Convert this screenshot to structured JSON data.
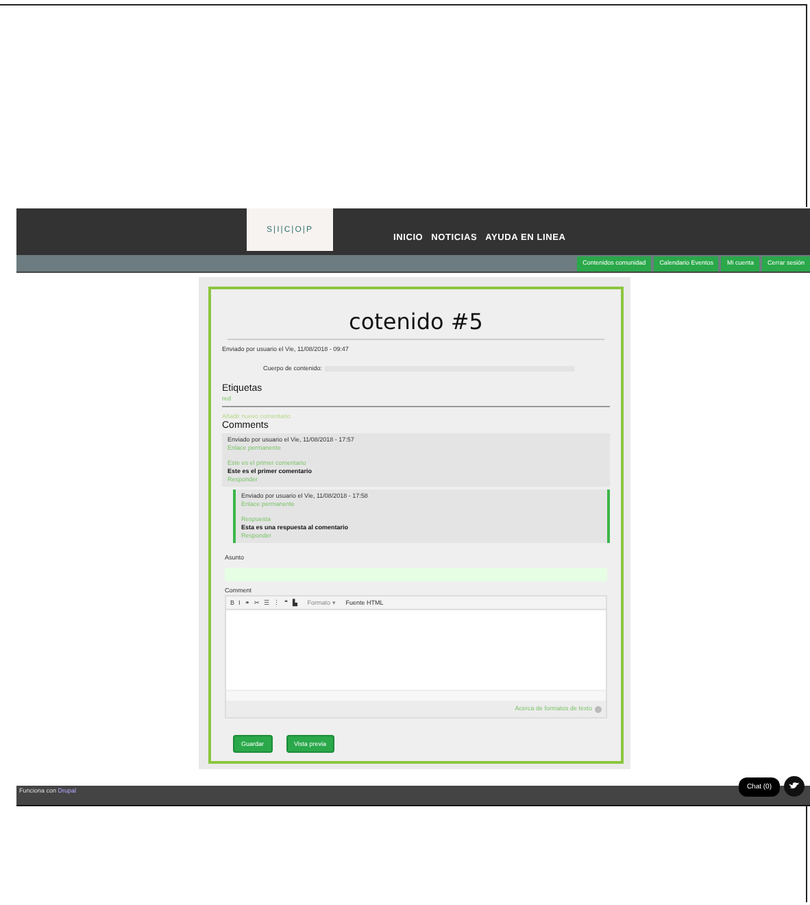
{
  "header": {
    "logo": "S|I|C|O|P",
    "nav": [
      "INICIO",
      "NOTICIAS",
      "AYUDA EN LINEA"
    ],
    "user_menu": [
      "Contenidos comunidad",
      "Calendario Eventos",
      "Mi cuenta",
      "Cerrar sesión"
    ]
  },
  "article": {
    "title": "cotenido #5",
    "meta": "Enviado por usuario el Vie, 11/08/2018 - 09:47",
    "body_label": "Cuerpo de contenido:",
    "tags_heading": "Etiquetas",
    "tags": [
      "red"
    ],
    "add_comment_link": "Añadir nuevo comentario"
  },
  "comments": {
    "heading": "Comments",
    "items": [
      {
        "meta": "Enviado por usuario el Vie, 11/08/2018 - 17:57",
        "permalink": "Enlace permanente",
        "subject": "Este es el primer comentario",
        "body": "Este es el primer comentario",
        "reply": "Responder",
        "children": [
          {
            "meta": "Enviado por usuario el Vie, 11/08/2018 - 17:58",
            "permalink": "Enlace permanente",
            "subject": "Respuesta",
            "body": "Esta es una respuesta al comentario",
            "reply": "Responder"
          }
        ]
      }
    ]
  },
  "form": {
    "subject_label": "Asunto",
    "comment_label": "Comment",
    "toolbar": [
      "B",
      "I",
      "⚭",
      "✂",
      "☰",
      "⋮",
      "❝",
      "▙"
    ],
    "format_select": "Formato ▾",
    "source_button": "Fuente HTML",
    "format_link": "Acerca de formatos de texto",
    "buttons": [
      "Guardar",
      "Vista previa"
    ]
  },
  "footer": {
    "text": "Funciona con",
    "link": "Drupal",
    "chat": "Chat (0)"
  }
}
